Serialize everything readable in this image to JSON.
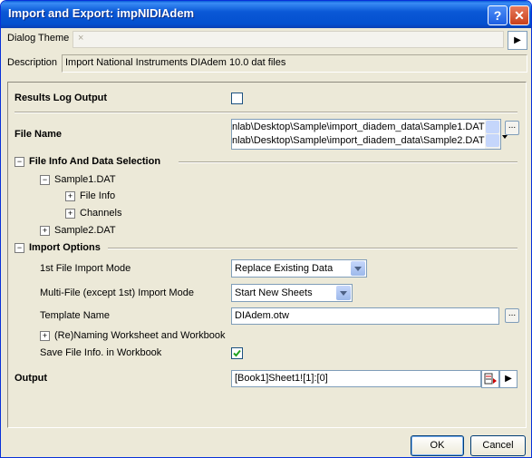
{
  "window": {
    "title": "Import and Export: impNIDIAdem",
    "help_symbol": "?",
    "close_symbol": "✕"
  },
  "theme": {
    "label": "Dialog Theme",
    "value": "×",
    "arrow": "▶"
  },
  "description": {
    "label": "Description",
    "value": "Import National Instruments DIAdem 10.0 dat files"
  },
  "results_log": {
    "label": "Results Log Output",
    "checked": false
  },
  "file_name": {
    "label": "File Name",
    "lines": [
      "nlab\\Desktop\\Sample\\import_diadem_data\\Sample1.DAT",
      "nlab\\Desktop\\Sample\\import_diadem_data\\Sample2.DAT"
    ],
    "browse": "..."
  },
  "file_info": {
    "label": "File Info And Data Selection",
    "sample1": "Sample1.DAT",
    "file_info_node": "File Info",
    "channels_node": "Channels",
    "sample2": "Sample2.DAT"
  },
  "import_options": {
    "label": "Import Options",
    "first_mode_label": "1st File Import Mode",
    "first_mode_value": "Replace Existing Data",
    "multi_mode_label": "Multi-File (except 1st) Import Mode",
    "multi_mode_value": "Start New Sheets",
    "template_label": "Template Name",
    "template_value": "DIAdem.otw",
    "template_browse": "...",
    "renaming_label": "(Re)Naming Worksheet and Workbook",
    "save_info_label": "Save File Info. in Workbook",
    "save_info_checked": true
  },
  "output": {
    "label": "Output",
    "value": "[Book1]Sheet1![1]:[0]",
    "arrow": "▶"
  },
  "buttons": {
    "ok": "OK",
    "cancel": "Cancel"
  },
  "tree": {
    "minus": "−",
    "plus": "+"
  },
  "colors": {
    "title_bar": "#0a58d6",
    "dialog_bg": "#ece9d8",
    "field_border": "#7f9db9",
    "check_green": "#21a121"
  }
}
